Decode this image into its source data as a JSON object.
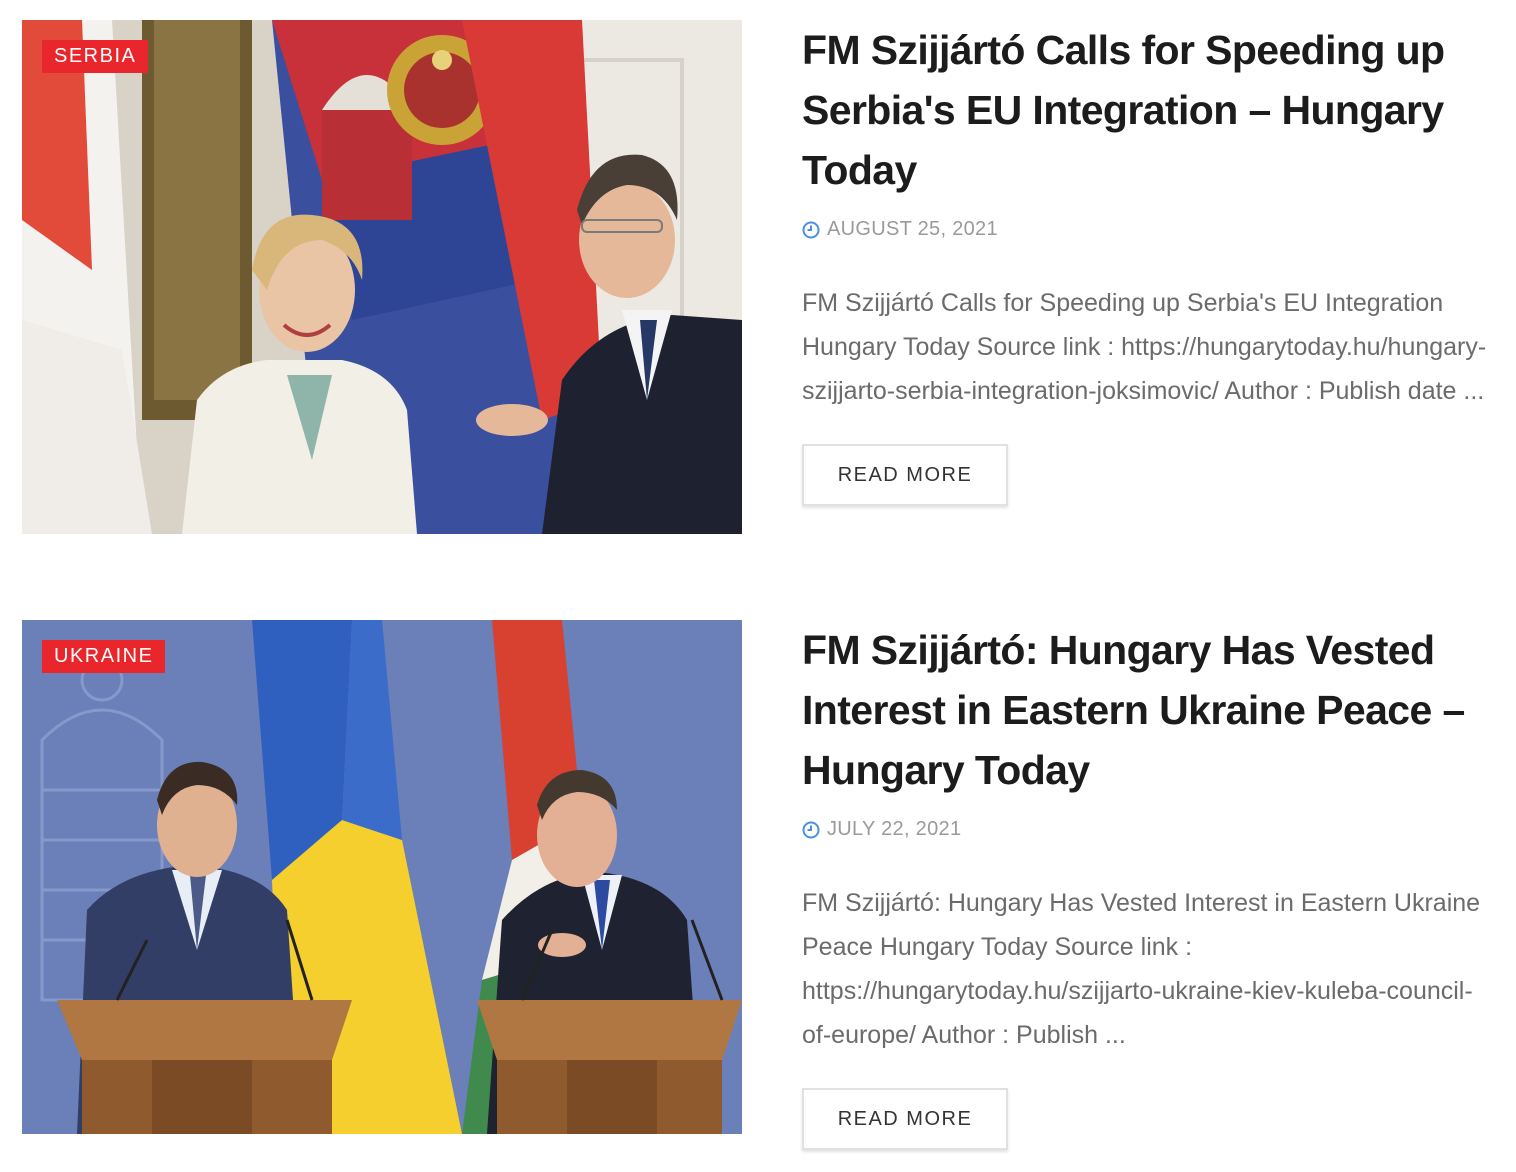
{
  "posts": [
    {
      "category": "SERBIA",
      "title": "FM Szijjártó Calls for Speeding up Serbia's EU Integration – Hungary Today",
      "date": "AUGUST 25, 2021",
      "excerpt": "FM Szijjártó Calls for Speeding up Serbia's EU Integration  Hungary Today Source link : https://hungarytoday.hu/hungary-szijjarto-serbia-integration-joksimovic/ Author : Publish date ...",
      "read_more": "READ MORE"
    },
    {
      "category": "UKRAINE",
      "title": "FM Szijjártó: Hungary Has Vested Interest in Eastern Ukraine Peace – Hungary Today",
      "date": "JULY 22, 2021",
      "excerpt": "FM Szijjártó: Hungary Has Vested Interest in Eastern Ukraine Peace  Hungary Today Source link : https://hungarytoday.hu/szijjarto-ukraine-kiev-kuleba-council-of-europe/ Author : Publish ...",
      "read_more": "READ MORE"
    }
  ],
  "colors": {
    "badge": "#e8262b",
    "meta_icon": "#4a90e2",
    "title": "#1c1c1c",
    "excerpt": "#6b6b6b"
  },
  "icons": {
    "date": "clock-icon"
  }
}
